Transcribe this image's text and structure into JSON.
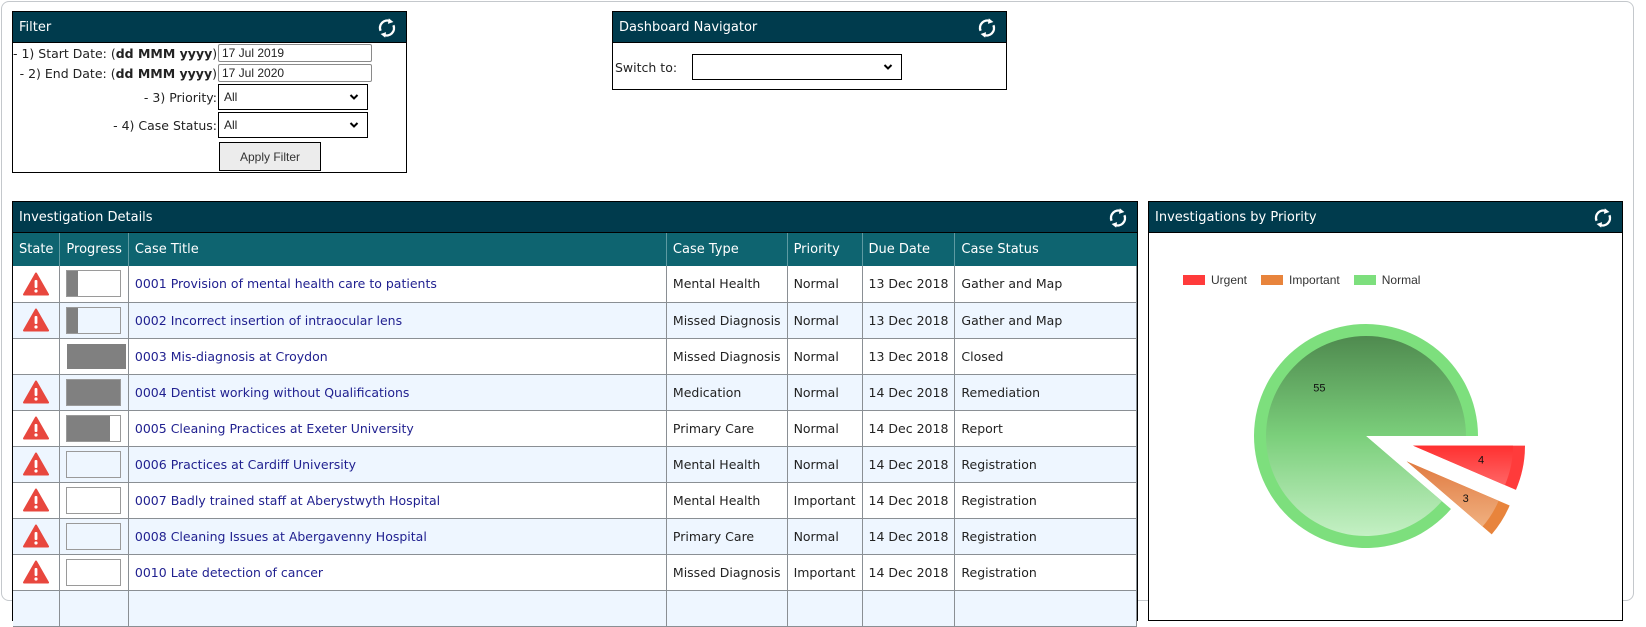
{
  "filter": {
    "title": "Filter",
    "start_date": {
      "prefix": "- 1) Start Date: (",
      "format": "dd MMM yyyy",
      "suffix": ")",
      "value": "17 Jul 2019"
    },
    "end_date": {
      "prefix": "- 2) End Date: (",
      "format": "dd MMM yyyy",
      "suffix": ")",
      "value": "17 Jul 2020"
    },
    "priority": {
      "label": "- 3) Priority:",
      "value": "All"
    },
    "case_status": {
      "label": "- 4) Case Status:",
      "value": "All"
    },
    "apply_label": "Apply Filter",
    "refresh_icon": "refresh-icon"
  },
  "navigator": {
    "title": "Dashboard Navigator",
    "switch_label": "Switch to:",
    "switch_value": ""
  },
  "details": {
    "title": "Investigation Details",
    "columns": [
      "State",
      "Progress",
      "Case Title",
      "Case Type",
      "Priority",
      "Due Date",
      "Case Status"
    ],
    "rows": [
      {
        "warning": true,
        "progress": 0.2,
        "title": "0001 Provision of mental health care to patients",
        "type": "Mental Health",
        "priority": "Normal",
        "due": "13 Dec 2018",
        "status": "Gather and Map"
      },
      {
        "warning": true,
        "progress": 0.2,
        "title": "0002 Incorrect insertion of intraocular lens",
        "type": "Missed Diagnosis",
        "priority": "Normal",
        "due": "13 Dec 2018",
        "status": "Gather and Map"
      },
      {
        "warning": false,
        "progress": 1.1,
        "title": "0003 Mis-diagnosis at Croydon",
        "type": "Missed Diagnosis",
        "priority": "Normal",
        "due": "13 Dec 2018",
        "status": "Closed"
      },
      {
        "warning": true,
        "progress": 1.0,
        "title": "0004 Dentist working without Qualifications",
        "type": "Medication",
        "priority": "Normal",
        "due": "14 Dec 2018",
        "status": "Remediation"
      },
      {
        "warning": true,
        "progress": 0.8,
        "title": "0005 Cleaning Practices at Exeter University",
        "type": "Primary Care",
        "priority": "Normal",
        "due": "14 Dec 2018",
        "status": "Report"
      },
      {
        "warning": true,
        "progress": 0.0,
        "title": "0006 Practices at Cardiff University",
        "type": "Mental Health",
        "priority": "Normal",
        "due": "14 Dec 2018",
        "status": "Registration"
      },
      {
        "warning": true,
        "progress": 0.0,
        "title": "0007 Badly trained staff at Aberystwyth Hospital",
        "type": "Mental Health",
        "priority": "Important",
        "due": "14 Dec 2018",
        "status": "Registration"
      },
      {
        "warning": true,
        "progress": 0.0,
        "title": "0008 Cleaning Issues at Abergavenny Hospital",
        "type": "Primary Care",
        "priority": "Normal",
        "due": "14 Dec 2018",
        "status": "Registration"
      },
      {
        "warning": true,
        "progress": 0.0,
        "title": "0010 Late detection of cancer",
        "type": "Missed Diagnosis",
        "priority": "Important",
        "due": "14 Dec 2018",
        "status": "Registration"
      },
      {
        "warning": null,
        "progress": null,
        "title": "",
        "type": "",
        "priority": "",
        "due": "",
        "status": ""
      }
    ]
  },
  "pie_panel": {
    "title": "Investigations by Priority"
  },
  "chart_data": {
    "type": "pie",
    "title": "Investigations by Priority",
    "legend": [
      "Urgent",
      "Important",
      "Normal"
    ],
    "legend_position": "top-left",
    "slices": [
      {
        "label": "Urgent",
        "value": 4,
        "color": "#ff3b3b",
        "exploded": true
      },
      {
        "label": "Important",
        "value": 3,
        "color": "#e8843c",
        "exploded": true
      },
      {
        "label": "Normal",
        "value": 55,
        "color": "#7ddf7d",
        "exploded": false
      }
    ]
  },
  "colors": {
    "header_dark": "#003b4d",
    "header_teal": "#0e6470",
    "warning": "#e8473e",
    "link": "#1f1f8f"
  }
}
